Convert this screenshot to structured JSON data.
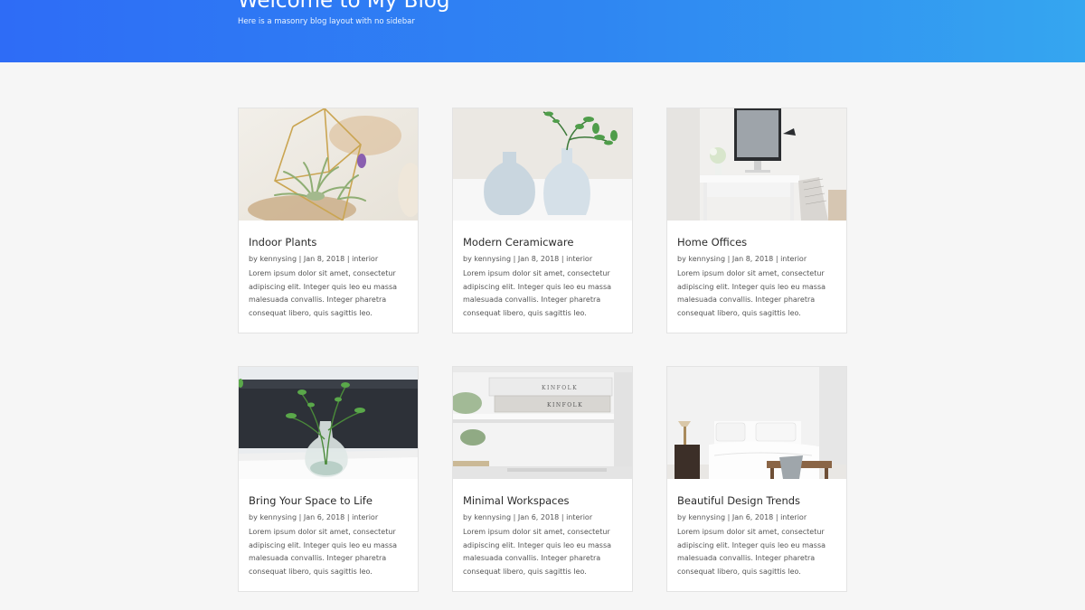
{
  "header": {
    "title": "Welcome to My Blog",
    "subtitle": "Here is a masonry blog layout with no sidebar"
  },
  "posts": [
    {
      "title": "Indoor Plants",
      "author": "kennysing",
      "date": "Jan 8, 2018",
      "category": "interior",
      "excerpt": "Lorem ipsum dolor sit amet, consectetur adipiscing elit. Integer quis leo eu massa malesuada convallis. Integer pharetra consequat libero, quis sagittis leo.",
      "image": "air-plants-in-geometric-terrarium"
    },
    {
      "title": "Modern Ceramicware",
      "author": "kennysing",
      "date": "Jan 8, 2018",
      "category": "interior",
      "excerpt": "Lorem ipsum dolor sit amet, consectetur adipiscing elit. Integer quis leo eu massa malesuada convallis. Integer pharetra consequat libero, quis sagittis leo.",
      "image": "white-ceramic-vases-with-plant"
    },
    {
      "title": "Home Offices",
      "author": "kennysing",
      "date": "Jan 8, 2018",
      "category": "interior",
      "excerpt": "Lorem ipsum dolor sit amet, consectetur adipiscing elit. Integer quis leo eu massa malesuada convallis. Integer pharetra consequat libero, quis sagittis leo.",
      "image": "white-desk-with-monitor"
    },
    {
      "title": "Bring Your Space to Life",
      "author": "kennysing",
      "date": "Jan 6, 2018",
      "category": "interior",
      "excerpt": "Lorem ipsum dolor sit amet, consectetur adipiscing elit. Integer quis leo eu massa malesuada convallis. Integer pharetra consequat libero, quis sagittis leo.",
      "image": "plant-in-glass-vase"
    },
    {
      "title": "Minimal Workspaces",
      "author": "kennysing",
      "date": "Jan 6, 2018",
      "category": "interior",
      "excerpt": "Lorem ipsum dolor sit amet, consectetur adipiscing elit. Integer quis leo eu massa malesuada convallis. Integer pharetra consequat libero, quis sagittis leo.",
      "image": "books-on-white-shelf",
      "book_spine_text": "KINFOLK"
    },
    {
      "title": "Beautiful Design Trends",
      "author": "kennysing",
      "date": "Jan 6, 2018",
      "category": "interior",
      "excerpt": "Lorem ipsum dolor sit amet, consectetur adipiscing elit. Integer quis leo eu massa malesuada convallis. Integer pharetra consequat libero, quis sagittis leo.",
      "image": "white-bedroom"
    }
  ],
  "meta_separator": "|",
  "colors": {
    "hero_start": "#2e6cf6",
    "hero_end": "#35a6f0",
    "page_background": "#f6f6f6",
    "card_background": "#ffffff",
    "text": "#2b2b2b",
    "meta_text": "#555555"
  }
}
